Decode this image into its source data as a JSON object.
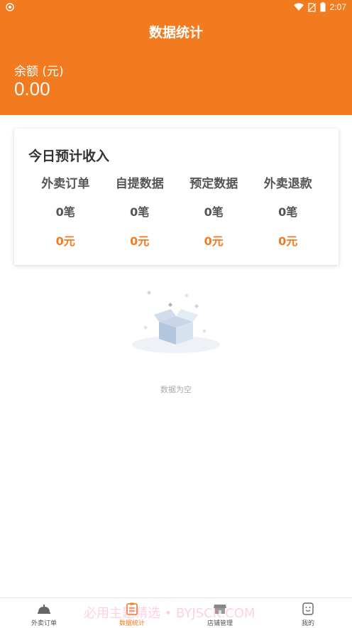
{
  "status_bar": {
    "time": "2:07"
  },
  "header": {
    "title": "数据统计",
    "balance_label": "余额 (元)",
    "balance_value": "0.00"
  },
  "income_card": {
    "title": "今日预计收入",
    "columns": [
      {
        "name": "外卖订单",
        "count": "0笔",
        "amount": "0元"
      },
      {
        "name": "自提数据",
        "count": "0笔",
        "amount": "0元"
      },
      {
        "name": "预定数据",
        "count": "0笔",
        "amount": "0元"
      },
      {
        "name": "外卖退款",
        "count": "0笔",
        "amount": "0元"
      }
    ]
  },
  "empty_state": {
    "text": "数据为空"
  },
  "tabbar": {
    "tabs": [
      {
        "label": "外卖订单",
        "icon": "cloche-icon"
      },
      {
        "label": "数据统计",
        "icon": "clipboard-icon",
        "active": true
      },
      {
        "label": "店铺管理",
        "icon": "store-icon"
      },
      {
        "label": "我的",
        "icon": "face-icon"
      }
    ]
  },
  "watermark": "必用主题精选 • BYJSCK.COM",
  "colors": {
    "accent": "#f27b1f"
  }
}
